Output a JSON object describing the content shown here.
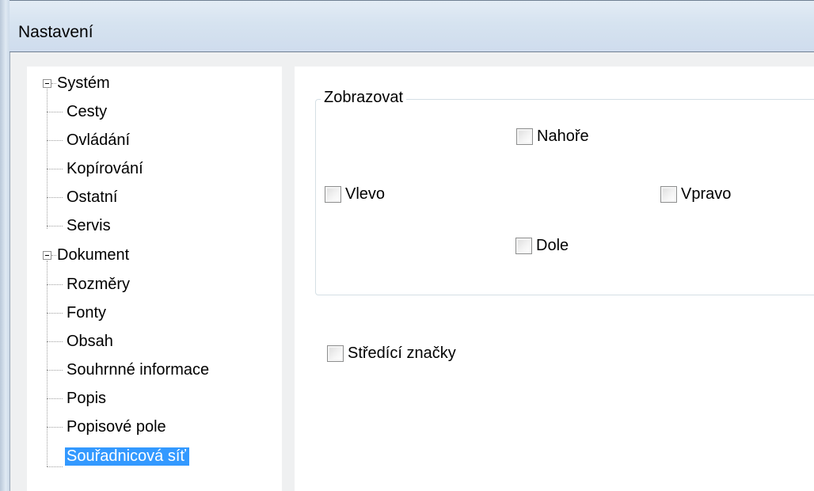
{
  "window": {
    "title": "Nastavení"
  },
  "tree": {
    "groups": [
      {
        "label": "Systém",
        "children": [
          "Cesty",
          "Ovládání",
          "Kopírování",
          "Ostatní",
          "Servis"
        ]
      },
      {
        "label": "Dokument",
        "children": [
          "Rozměry",
          "Fonty",
          "Obsah",
          "Souhrnné informace",
          "Popis",
          "Popisové pole",
          "Souřadnicová síť"
        ]
      }
    ],
    "selected": "Souřadnicová síť"
  },
  "display_group": {
    "legend": "Zobrazovat",
    "top": {
      "label": "Nahoře",
      "checked": false
    },
    "left": {
      "label": "Vlevo",
      "checked": false
    },
    "right": {
      "label": "Vpravo",
      "checked": false
    },
    "bottom": {
      "label": "Dole",
      "checked": false
    }
  },
  "center_marks": {
    "label": "Středící značky",
    "checked": false
  },
  "colors": {
    "selection": "#3399ff"
  }
}
